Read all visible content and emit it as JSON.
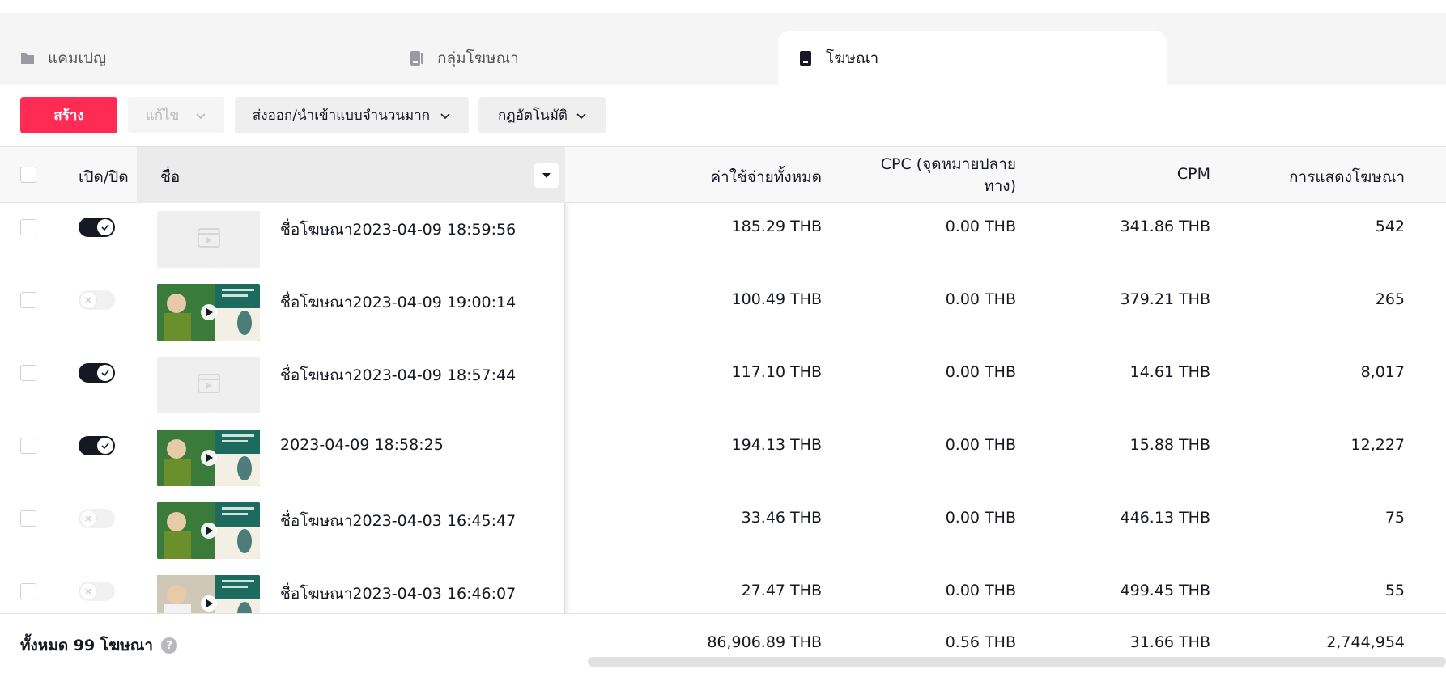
{
  "tabs": [
    {
      "label": "แคมเปญ",
      "icon": "folder-icon"
    },
    {
      "label": "กลุ่มโฆษณา",
      "icon": "ad-group-icon"
    },
    {
      "label": "โฆษณา",
      "icon": "ad-icon",
      "active": true
    }
  ],
  "toolbar": {
    "create_label": "สร้าง",
    "edit_label": "แก้ไข",
    "bulk_label": "ส่งออก/นำเข้าแบบจำนวนมาก",
    "rules_label": "กฎอัตโนมัติ"
  },
  "table": {
    "headers": {
      "toggle": "เปิด/ปิด",
      "name": "ชื่อ",
      "spend": "ค่าใช้จ่ายทั้งหมด",
      "cpc_line1": "CPC (จุดหมายปลาย",
      "cpc_line2": "ทาง)",
      "cpm": "CPM",
      "impressions": "การแสดงโฆษณา"
    },
    "rows": [
      {
        "on": true,
        "thumb": "empty",
        "name": "ชื่อโฆษณา2023-04-09 18:59:56",
        "spend": "185.29 THB",
        "cpc": "0.00 THB",
        "cpm": "341.86 THB",
        "impressions": "542"
      },
      {
        "on": false,
        "thumb": "video",
        "name": "ชื่อโฆษณา2023-04-09 19:00:14",
        "spend": "100.49 THB",
        "cpc": "0.00 THB",
        "cpm": "379.21 THB",
        "impressions": "265"
      },
      {
        "on": true,
        "thumb": "empty",
        "name": "ชื่อโฆษณา2023-04-09 18:57:44",
        "spend": "117.10 THB",
        "cpc": "0.00 THB",
        "cpm": "14.61 THB",
        "impressions": "8,017"
      },
      {
        "on": true,
        "thumb": "video",
        "name": "2023-04-09 18:58:25",
        "spend": "194.13 THB",
        "cpc": "0.00 THB",
        "cpm": "15.88 THB",
        "impressions": "12,227"
      },
      {
        "on": false,
        "thumb": "video",
        "name": "ชื่อโฆษณา2023-04-03 16:45:47",
        "spend": "33.46 THB",
        "cpc": "0.00 THB",
        "cpm": "446.13 THB",
        "impressions": "75"
      },
      {
        "on": false,
        "thumb": "video2",
        "name": "ชื่อโฆษณา2023-04-03 16:46:07",
        "spend": "27.47 THB",
        "cpc": "0.00 THB",
        "cpm": "499.45 THB",
        "impressions": "55"
      }
    ],
    "footer": {
      "label": "ทั้งหมด 99 โฆษณา",
      "spend": "86,906.89 THB",
      "cpc": "0.56 THB",
      "cpm": "31.66 THB",
      "impressions": "2,744,954"
    }
  },
  "colors": {
    "brand": "#fe2c55",
    "toggle_on": "#161823",
    "toggle_off": "#f1f1f2"
  }
}
